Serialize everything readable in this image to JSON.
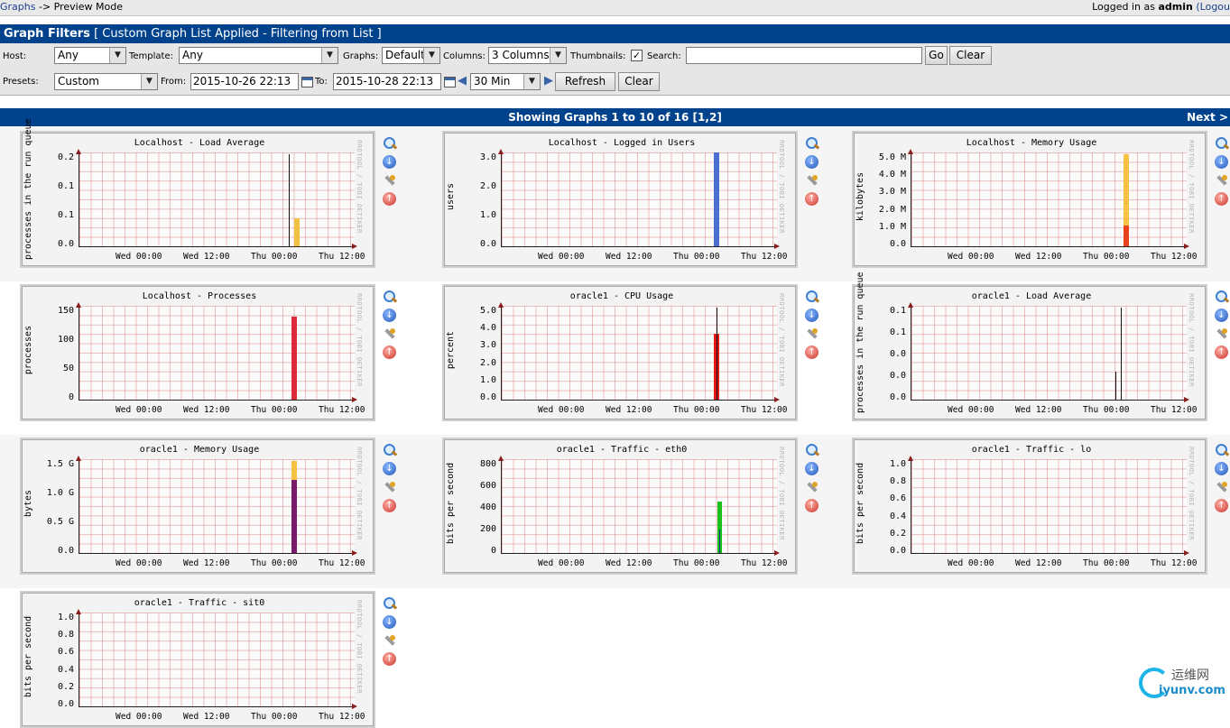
{
  "breadcrumb": {
    "graphs_link": "Graphs",
    "separator": "->",
    "current": "Preview Mode"
  },
  "login": {
    "prefix": "Logged in as",
    "user": "admin",
    "logout": "(Logou"
  },
  "filters": {
    "title": "Graph Filters",
    "subtitle": "[ Custom Graph List Applied - Filtering from List ]",
    "host_label": "Host:",
    "host_value": "Any",
    "template_label": "Template:",
    "template_value": "Any",
    "graphs_label": "Graphs:",
    "graphs_value": "Default",
    "columns_label": "Columns:",
    "columns_value": "3 Columns",
    "thumbnails_label": "Thumbnails:",
    "thumbnails_checked": true,
    "search_label": "Search:",
    "search_value": "",
    "search_placeholder": "",
    "go_label": "Go",
    "clear_label": "Clear",
    "presets_label": "Presets:",
    "presets_value": "Custom",
    "from_label": "From:",
    "from_value": "2015-10-26 22:13",
    "to_label": "To:",
    "to_value": "2015-10-28 22:13",
    "timespan_value": "30 Min",
    "refresh_label": "Refresh",
    "clear2_label": "Clear"
  },
  "results": {
    "showing_prefix": "Showing Graphs 1 to 10 of 16 [",
    "page_current": "1",
    "page_sep": ",",
    "page_other": "2",
    "showing_suffix": "]",
    "next_label": "Next >"
  },
  "x_ticks": [
    "Wed 00:00",
    "Wed 12:00",
    "Thu 00:00",
    "Thu 12:00"
  ],
  "rrd_vertical_text": "RRDTOOL / TOBI OETIKER",
  "graphs": [
    {
      "title": "Localhost - Load Average",
      "ylabel": "processes in the run queue",
      "yticks": [
        "0.2",
        "0.1",
        "0.1",
        "0.0"
      ],
      "color": "#f0c040",
      "spikes": [
        {
          "at": 0.76,
          "level": 0.98,
          "color": "#111111"
        }
      ],
      "bars": [
        {
          "from": 0.78,
          "to": 0.8,
          "level": 0.3,
          "color": "#f0c040"
        }
      ]
    },
    {
      "title": "Localhost - Logged in Users",
      "ylabel": "users",
      "yticks": [
        "3.0",
        "2.0",
        "1.0",
        "0.0"
      ],
      "color": "#4a6fd1",
      "bars": [
        {
          "from": 0.77,
          "to": 0.79,
          "level": 1.0,
          "color": "#4a6fd1"
        }
      ]
    },
    {
      "title": "Localhost - Memory Usage",
      "ylabel": "kilobytes",
      "yticks": [
        "5.0 M",
        "4.0 M",
        "3.0 M",
        "2.0 M",
        "1.0 M",
        "0.0"
      ],
      "color": "#f5c242",
      "bars": [
        {
          "from": 0.77,
          "to": 0.79,
          "level": 0.98,
          "color": "#f5c242"
        },
        {
          "from": 0.77,
          "to": 0.79,
          "level": 0.22,
          "color": "#e8421a"
        }
      ]
    },
    {
      "title": "Localhost - Processes",
      "ylabel": "processes",
      "yticks": [
        "150",
        "100",
        "50",
        "0"
      ],
      "color": "#dc2a3a",
      "bars": [
        {
          "from": 0.77,
          "to": 0.79,
          "level": 0.88,
          "color": "#dc2a3a"
        }
      ]
    },
    {
      "title": "oracle1 - CPU Usage",
      "ylabel": "percent",
      "yticks": [
        "5.0",
        "4.0",
        "3.0",
        "2.0",
        "1.0",
        "0.0"
      ],
      "color": "#e01818",
      "bars": [
        {
          "from": 0.77,
          "to": 0.79,
          "level": 0.7,
          "color": "#e01818"
        }
      ],
      "spikes": [
        {
          "at": 0.78,
          "level": 0.98,
          "color": "#111111"
        }
      ]
    },
    {
      "title": "oracle1 - Load Average",
      "ylabel": "processes in the run queue",
      "yticks": [
        "0.1",
        "0.1",
        "0.0",
        "0.0",
        "0.0"
      ],
      "color": "#f0c040",
      "spikes": [
        {
          "at": 0.76,
          "level": 0.98,
          "color": "#111111"
        },
        {
          "at": 0.74,
          "level": 0.3,
          "color": "#111111"
        }
      ]
    },
    {
      "title": "oracle1 - Memory Usage",
      "ylabel": "bytes",
      "yticks": [
        "1.5 G",
        "1.0 G",
        "0.5 G",
        "0.0"
      ],
      "color": "#7a1a6a",
      "bars": [
        {
          "from": 0.77,
          "to": 0.79,
          "level": 0.98,
          "color": "#f5c242"
        },
        {
          "from": 0.77,
          "to": 0.79,
          "level": 0.78,
          "color": "#7a1a6a"
        }
      ]
    },
    {
      "title": "oracle1 - Traffic - eth0",
      "ylabel": "bits per second",
      "yticks": [
        "800",
        "600",
        "400",
        "200",
        "0"
      ],
      "color": "#19c219",
      "bars": [
        {
          "from": 0.785,
          "to": 0.8,
          "level": 0.55,
          "color": "#19c219"
        }
      ],
      "spikes": [
        {
          "at": 0.79,
          "level": 0.25,
          "color": "#1a2a8a"
        }
      ]
    },
    {
      "title": "oracle1 - Traffic - lo",
      "ylabel": "bits per second",
      "yticks": [
        "1.0",
        "0.8",
        "0.6",
        "0.4",
        "0.2",
        "0.0"
      ],
      "color": "#19c219",
      "bars": []
    },
    {
      "title": "oracle1 - Traffic - sit0",
      "ylabel": "bits per second",
      "yticks": [
        "1.0",
        "0.8",
        "0.6",
        "0.4",
        "0.2",
        "0.0"
      ],
      "color": "#19c219",
      "bars": []
    }
  ],
  "icons": [
    "zoom-icon",
    "csv-export-icon",
    "edit-icon",
    "move-up-icon"
  ],
  "watermark": {
    "cn": "运维网",
    "en": "iyunv.com"
  }
}
